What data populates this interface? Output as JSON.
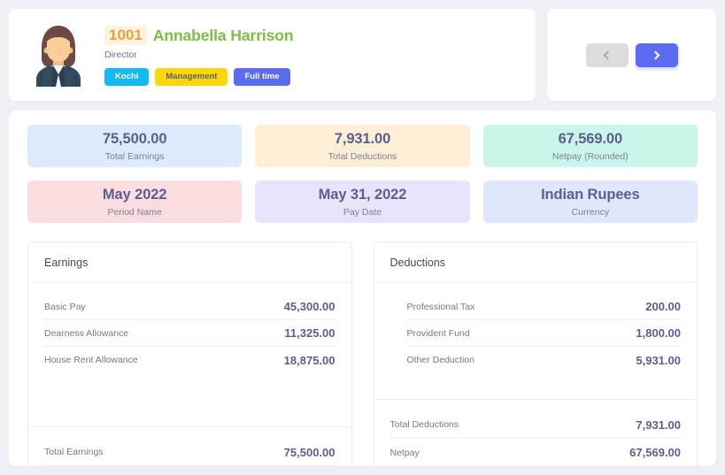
{
  "employee": {
    "id": "1001",
    "name": "Annabella Harrison",
    "title": "Director",
    "badges": [
      {
        "label": "Kochi",
        "style": "cyan"
      },
      {
        "label": "Management",
        "style": "yellow"
      },
      {
        "label": "Full time",
        "style": "indigo"
      }
    ],
    "avatar_name": "employee-avatar"
  },
  "navigation": {
    "prev_icon": "chevron-left-icon",
    "next_icon": "chevron-right-icon"
  },
  "summary": [
    {
      "value": "75,500.00",
      "label": "Total Earnings",
      "bg": "#ddeafc"
    },
    {
      "value": "7,931.00",
      "label": "Total Deductions",
      "bg": "#fdeed5"
    },
    {
      "value": "67,569.00",
      "label": "Netpay (Rounded)",
      "bg": "#c9f5ea"
    },
    {
      "value": "May 2022",
      "label": "Period Name",
      "bg": "#fbdcdf"
    },
    {
      "value": "May 31, 2022",
      "label": "Pay Date",
      "bg": "#e8e4fb"
    },
    {
      "value": "Indian Rupees",
      "label": "Currency",
      "bg": "#dfe7fb"
    }
  ],
  "earnings": {
    "title": "Earnings",
    "items": [
      {
        "label": "Basic Pay",
        "value": "45,300.00"
      },
      {
        "label": "Dearness Allowance",
        "value": "11,325.00"
      },
      {
        "label": "House Rent Allowance",
        "value": "18,875.00"
      }
    ],
    "totals": [
      {
        "label": "Total Earnings",
        "value": "75,500.00"
      }
    ]
  },
  "deductions": {
    "title": "Deductions",
    "items": [
      {
        "label": "Professional Tax",
        "value": "200.00"
      },
      {
        "label": "Provident Fund",
        "value": "1,800.00"
      },
      {
        "label": "Other Deduction",
        "value": "5,931.00"
      }
    ],
    "totals": [
      {
        "label": "Total Deductions",
        "value": "7,931.00"
      },
      {
        "label": "Netpay",
        "value": "67,569.00"
      }
    ]
  }
}
